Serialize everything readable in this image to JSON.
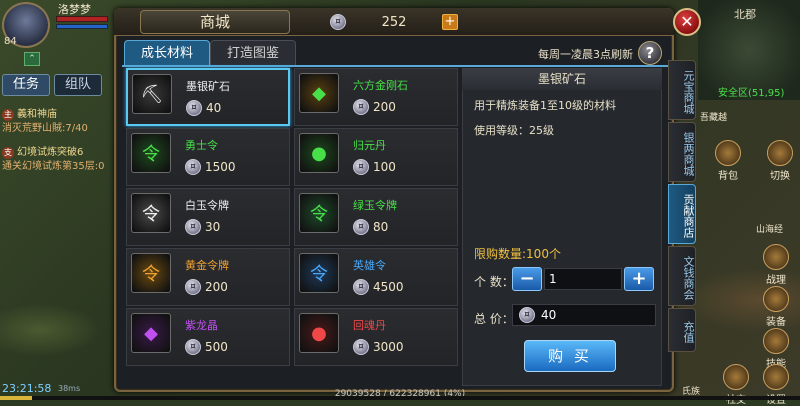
{
  "hud": {
    "player_name": "洛梦梦",
    "level": "84",
    "tabs": [
      "任务",
      "组队"
    ],
    "quests": [
      {
        "tag": "主",
        "title": "義和神庙",
        "detail": "消灭荒野山賊:7/40"
      },
      {
        "tag": "支",
        "title": "幻境试炼突破6",
        "detail": "通关幻境试炼第35层:0"
      }
    ],
    "clock": "23:21:58",
    "signal": "38ms",
    "exp_text": "29039528 / 622328961 (4%)",
    "exp_fraction": 0.04,
    "map_name": "北郡",
    "coords": "安全区(51,95)",
    "side_buttons": [
      "背包",
      "切换",
      "战理",
      "装备",
      "技能",
      "设置",
      "社交"
    ],
    "map_badges": [
      "吾藏越",
      "山海经",
      "氏族"
    ]
  },
  "shop": {
    "title": "商城",
    "currency_icon": "coin-icon",
    "balance": "252",
    "tabs": [
      "成长材料",
      "打造图鉴"
    ],
    "refresh_note": "每周一凌晨3点刷新",
    "side_tabs": [
      "元宝商城",
      "银两商城",
      "贡献商店",
      "文钱商会",
      "充值"
    ],
    "active_side_tab": 2,
    "items": [
      {
        "name": "墨银矿石",
        "price": "40",
        "color": "#f0f0f0",
        "icon": "ore-icon",
        "glyph": "⛏",
        "icon_bg": "#3a3a3a"
      },
      {
        "name": "六方金刚石",
        "price": "200",
        "color": "#48e048",
        "icon": "crystal-icon",
        "glyph": "◆",
        "icon_bg": "#5a4010"
      },
      {
        "name": "勇士令",
        "price": "1500",
        "color": "#48e048",
        "icon": "token-icon",
        "glyph": "令",
        "icon_bg": "#1e4a1e"
      },
      {
        "name": "归元丹",
        "price": "100",
        "color": "#48e048",
        "icon": "pill-icon",
        "glyph": "●",
        "icon_bg": "#1e4a1e"
      },
      {
        "name": "白玉令牌",
        "price": "30",
        "color": "#f0f0f0",
        "icon": "tablet-icon",
        "glyph": "令",
        "icon_bg": "#4a4a4a"
      },
      {
        "name": "绿玉令牌",
        "price": "80",
        "color": "#48e048",
        "icon": "tablet-icon",
        "glyph": "令",
        "icon_bg": "#1e4a2a"
      },
      {
        "name": "黄金令牌",
        "price": "200",
        "color": "#f0a030",
        "icon": "tablet-icon",
        "glyph": "令",
        "icon_bg": "#6a4a10"
      },
      {
        "name": "英雄令",
        "price": "4500",
        "color": "#48a8f8",
        "icon": "token-icon",
        "glyph": "令",
        "icon_bg": "#1e3a5a"
      },
      {
        "name": "紫龙晶",
        "price": "500",
        "color": "#c050f0",
        "icon": "crystal-icon",
        "glyph": "◆",
        "icon_bg": "#3a1a4a"
      },
      {
        "name": "回魂丹",
        "price": "3000",
        "color": "#f04848",
        "icon": "pill-icon",
        "glyph": "●",
        "icon_bg": "#4a1a1a"
      }
    ],
    "detail": {
      "title": "墨银矿石",
      "description": "用于精炼装备1至10级的材料",
      "level": "使用等级：25级",
      "limit": "限购数量:100个",
      "qty_label": "个 数：",
      "qty_value": "1",
      "total_label": "总 价：",
      "total_value": "40",
      "buy_label": "购 买"
    }
  },
  "colors": {
    "accent": "#5aa8d8",
    "frame": "#7a6440"
  }
}
